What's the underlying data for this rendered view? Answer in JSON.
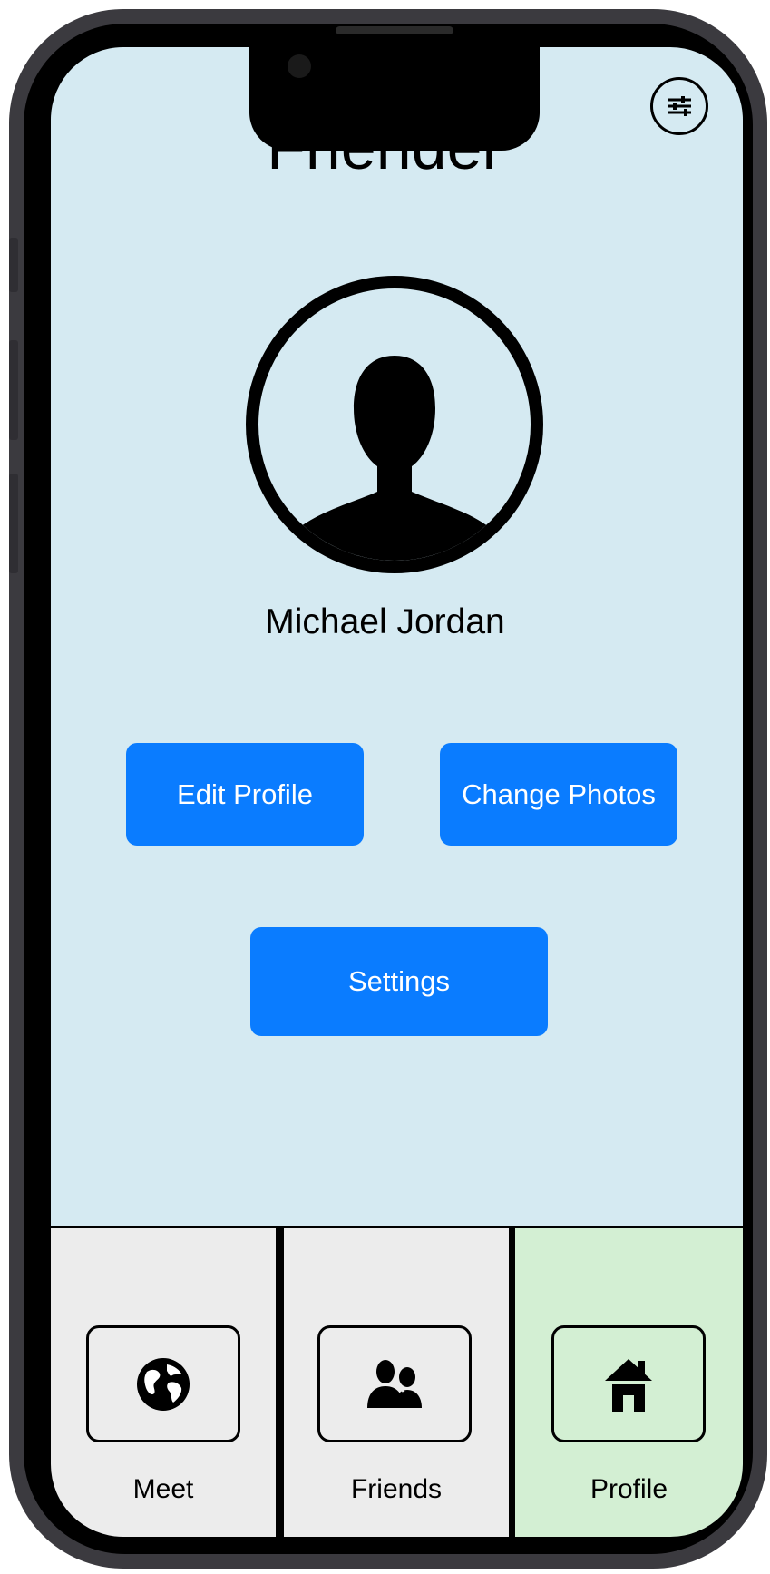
{
  "app": {
    "title": "Friender"
  },
  "header": {
    "filter_icon": "sliders-icon"
  },
  "profile": {
    "avatar_icon": "user-silhouette-icon",
    "name": "Michael Jordan"
  },
  "actions": {
    "edit_profile_label": "Edit Profile",
    "change_photos_label": "Change Photos",
    "settings_label": "Settings"
  },
  "tabs": [
    {
      "label": "Meet",
      "icon": "globe-icon",
      "active": false
    },
    {
      "label": "Friends",
      "icon": "people-icon",
      "active": false
    },
    {
      "label": "Profile",
      "icon": "home-icon",
      "active": true
    }
  ],
  "colors": {
    "screen_background": "#d5eaf2",
    "button_primary": "#0a7cff",
    "button_text": "#ffffff",
    "tab_inactive": "#ececec",
    "tab_active": "#d3efd3"
  }
}
